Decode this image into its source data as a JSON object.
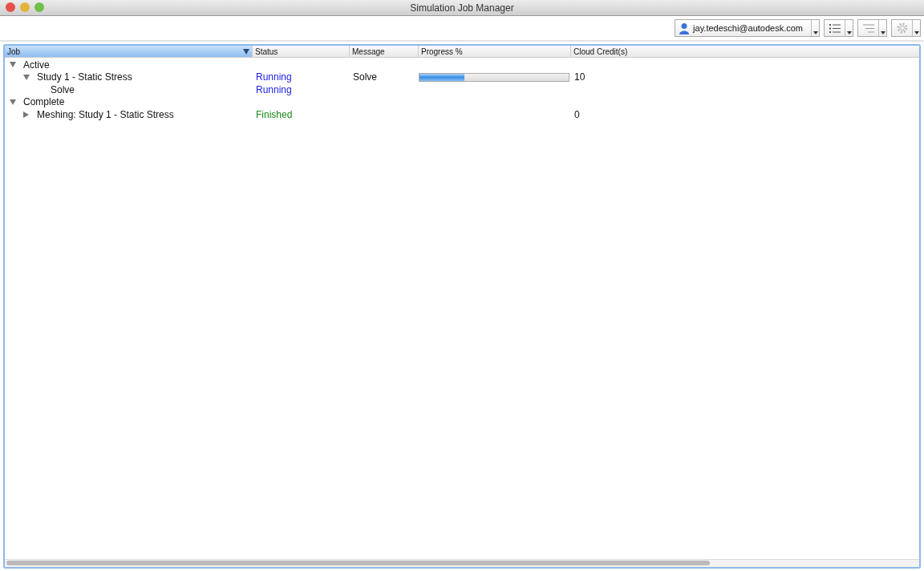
{
  "window": {
    "title": "Simulation Job Manager"
  },
  "toolbar": {
    "account": "jay.tedeschi@autodesk.com"
  },
  "table": {
    "columns": [
      {
        "label": "Job",
        "sorted": true
      },
      {
        "label": "Status",
        "sorted": false
      },
      {
        "label": "Message",
        "sorted": false
      },
      {
        "label": "Progress %",
        "sorted": false
      },
      {
        "label": "Cloud Credit(s)",
        "sorted": false
      }
    ],
    "rows": [
      {
        "job": "Active",
        "expanded": true,
        "children": [
          {
            "job": "Study 1 - Static Stress",
            "expanded": true,
            "status": "Running",
            "color": "#2222ee",
            "message": "Solve",
            "level": 0.3,
            "credits": "10",
            "children": [
              {
                "job": "Solve",
                "status": "Running",
                "color": "#2222ee"
              }
            ]
          }
        ]
      },
      {
        "job": "Complete",
        "expanded": true,
        "children": [
          {
            "job": "Meshing: Study 1 - Static Stress",
            "expanded": false,
            "status": "Finished",
            "color": "#1a8a1a",
            "credits": "0"
          }
        ]
      }
    ]
  }
}
